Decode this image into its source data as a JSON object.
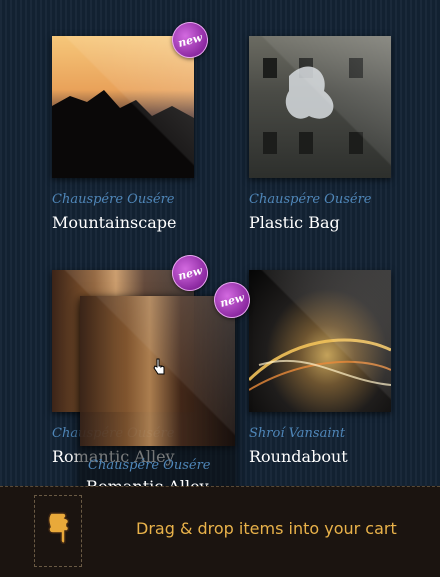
{
  "items": [
    {
      "author": "Chauspére Ousére",
      "title": "Mountainscape",
      "is_new": true,
      "badge": "new"
    },
    {
      "author": "Chauspére Ousére",
      "title": "Plastic Bag",
      "is_new": false
    },
    {
      "author": "Chauspére Ousére",
      "title": "Romantic Alley",
      "is_new": true,
      "badge": "new"
    },
    {
      "author": "Shroí Vansaint",
      "title": "Roundabout",
      "is_new": false
    }
  ],
  "dragging": {
    "author": "Chauspére Ousére",
    "title": "Romantic Alley",
    "badge": "new"
  },
  "cart": {
    "message": "Drag & drop items into your cart",
    "icon": "hand-pointer-icon"
  },
  "colors": {
    "author": "#4f86b8",
    "title": "#ffffff",
    "badge": "#a03ab6",
    "cart_text": "#e9b24a"
  }
}
